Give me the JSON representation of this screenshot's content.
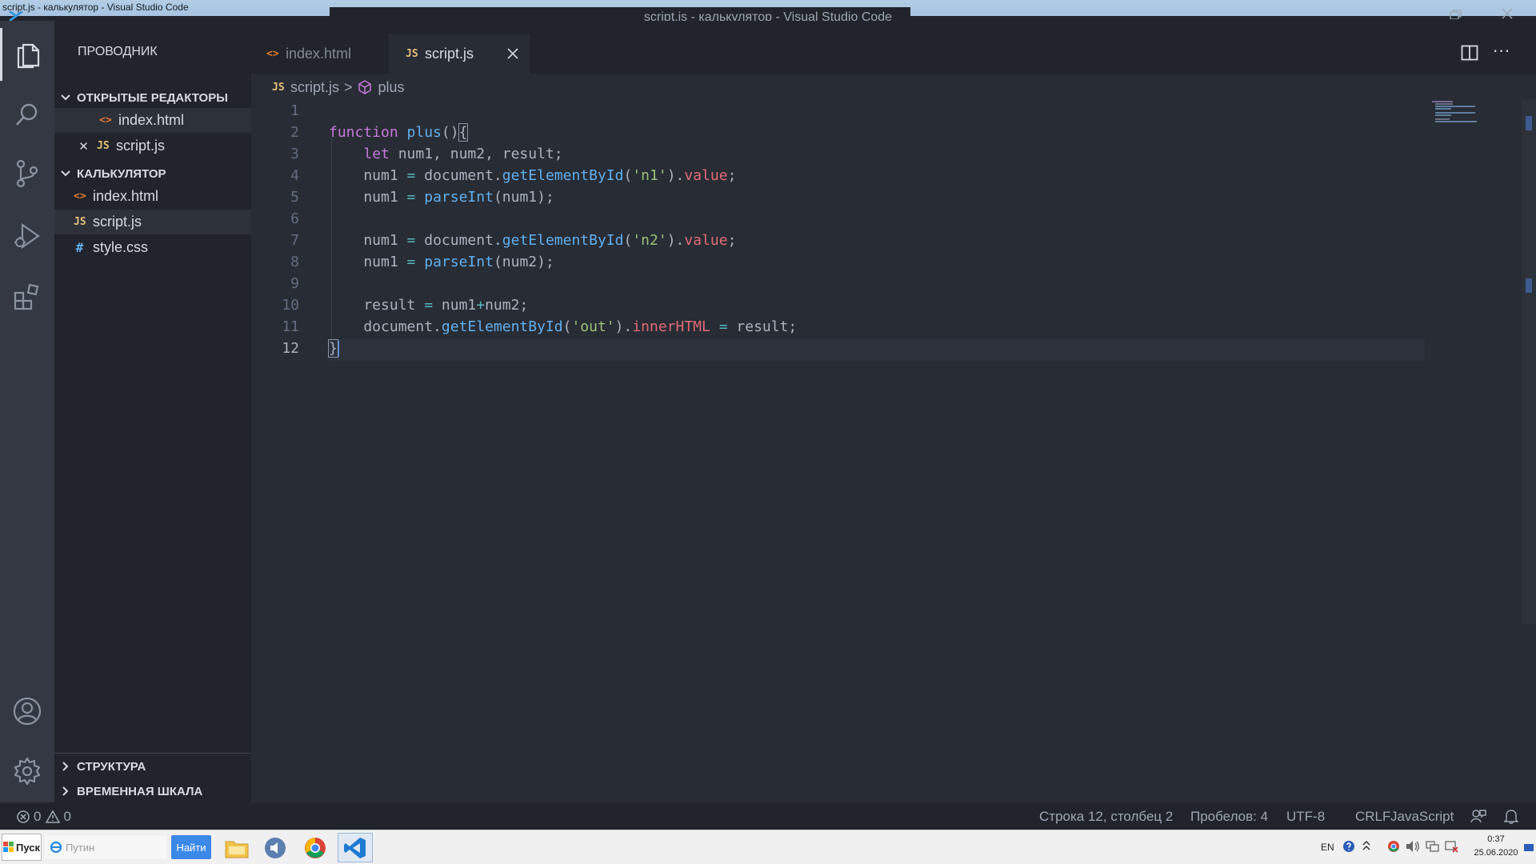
{
  "window": {
    "top_label": "script.js - калькулятор - Visual Studio Code",
    "title": "script.js - калькулятор - Visual Studio Code"
  },
  "sidebar": {
    "title": "ПРОВОДНИК",
    "open_editors": {
      "header": "ОТКРЫТЫЕ РЕДАКТОРЫ",
      "items": [
        {
          "icon": "<>",
          "label": "index.html"
        },
        {
          "icon": "JS",
          "label": "script.js"
        }
      ]
    },
    "folder": {
      "header": "КАЛЬКУЛЯТОР",
      "items": [
        {
          "icon": "<>",
          "label": "index.html"
        },
        {
          "icon": "JS",
          "label": "script.js"
        },
        {
          "icon": "#",
          "label": "style.css"
        }
      ]
    },
    "outline": "СТРУКТУРА",
    "timeline": "ВРЕМЕННАЯ ШКАЛА"
  },
  "tabs": [
    {
      "icon": "<>",
      "label": "index.html"
    },
    {
      "icon": "JS",
      "label": "script.js"
    }
  ],
  "breadcrumb": {
    "file_icon": "JS",
    "file": "script.js",
    "separator": ">",
    "symbol": "plus"
  },
  "editor": {
    "line_numbers": [
      "1",
      "2",
      "3",
      "4",
      "5",
      "6",
      "7",
      "8",
      "9",
      "10",
      "11",
      "12"
    ]
  },
  "statusbar": {
    "errors": "0",
    "warnings": "0",
    "position": "Строка 12, столбец 2",
    "spaces": "Пробелов: 4",
    "encoding": "UTF-8",
    "eol": "CRLF",
    "language": "JavaScript"
  },
  "taskbar": {
    "start": "Пуск",
    "search_placeholder": "Путин",
    "find": "Найти",
    "lang": "EN",
    "time": "0:37",
    "date": "25.06.2020"
  },
  "colors": {
    "editor_bg": "#282c34",
    "sidebar_bg": "#21252b",
    "activity_bg": "#333842",
    "keyword": "#c678dd",
    "function": "#61afef",
    "string": "#98c379",
    "property": "#e06c75",
    "operator": "#56b6c2"
  }
}
